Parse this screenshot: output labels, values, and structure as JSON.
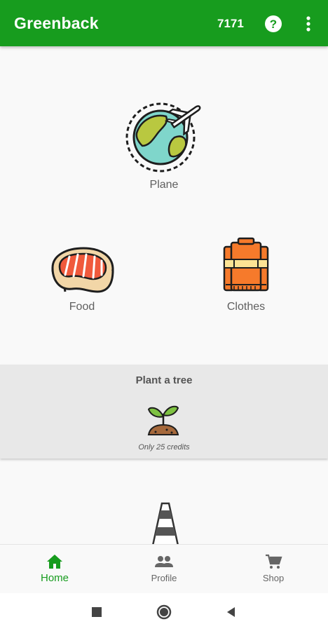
{
  "app_bar": {
    "title": "Greenback",
    "credits": "7171",
    "help_icon": "help-circle-icon",
    "more_icon": "more-vert-icon"
  },
  "categories": [
    {
      "label": "Plane",
      "icon": "plane-globe-icon"
    },
    {
      "label": "Food",
      "icon": "steak-icon"
    },
    {
      "label": "Clothes",
      "icon": "sweater-icon"
    }
  ],
  "plant_tree": {
    "title": "Plant a tree",
    "note": "Only 25 credits",
    "icon": "sprout-icon"
  },
  "bottom_nav": [
    {
      "label": "Home",
      "icon": "home-icon",
      "active": true
    },
    {
      "label": "Profile",
      "icon": "people-icon",
      "active": false
    },
    {
      "label": "Shop",
      "icon": "cart-icon",
      "active": false
    }
  ],
  "colors": {
    "brand": "#179c1e",
    "background": "#f9f9f9",
    "panel": "#e8e8e8"
  }
}
